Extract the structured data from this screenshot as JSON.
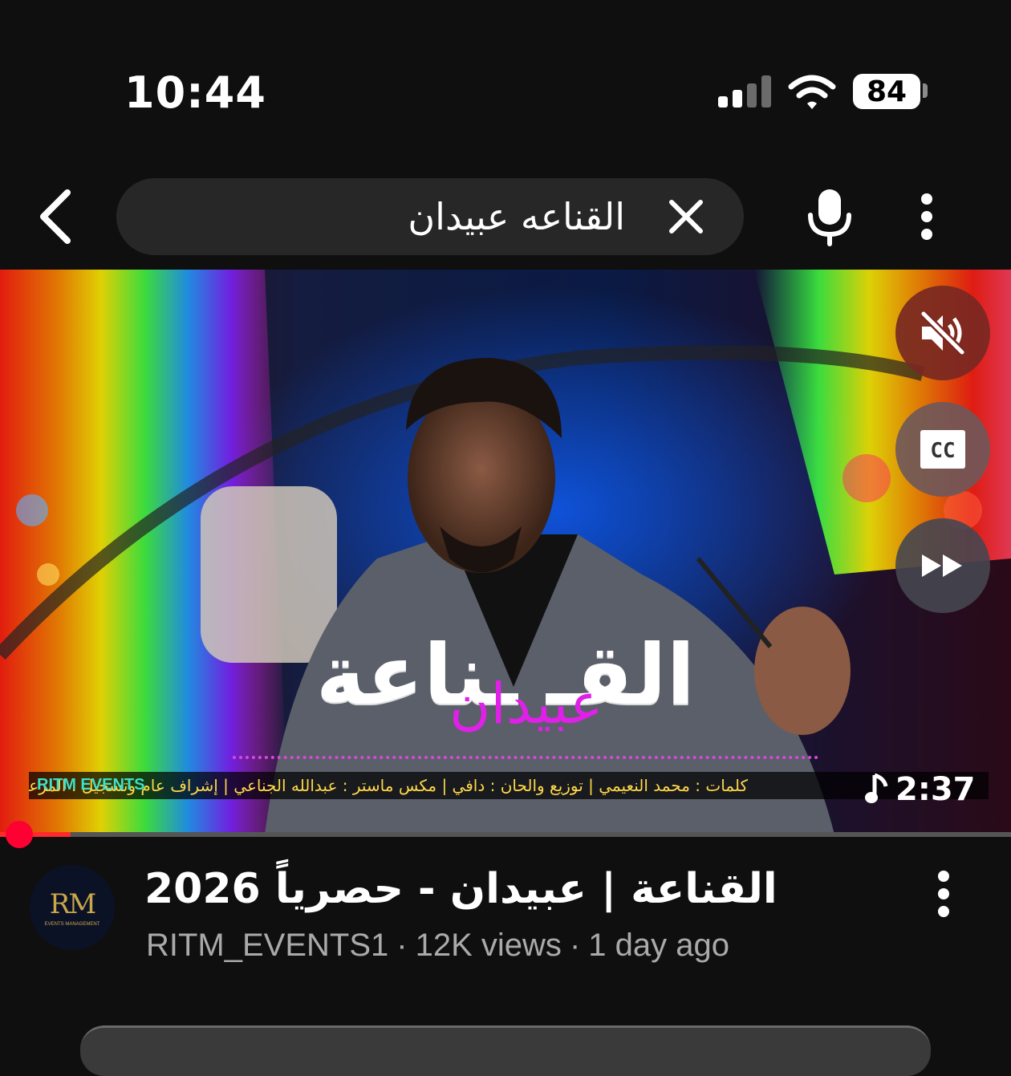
{
  "status_bar": {
    "time": "10:44",
    "battery": "84",
    "icons": [
      "signal-icon",
      "wifi-icon",
      "battery-icon"
    ]
  },
  "search": {
    "query": "القناعه عبيدان",
    "back_icon": "chevron-left-icon",
    "clear_icon": "close-icon",
    "mic_icon": "microphone-icon",
    "more_icon": "vertical-dots-icon"
  },
  "player": {
    "overlay_title_main": "القـ ـناعة",
    "overlay_title_name": "عبيدان",
    "credits": "كلمات : محمد النعيمي | توزيع والحان : دافي | مكس ماستر : عبدالله الجناعي | إشراف عام وتسجيل : المرعب | انتاج :",
    "credits_brand": "RITM EVENTS",
    "duration": "2:37",
    "progress_fraction": 0.07,
    "controls": [
      "mute-icon",
      "closed-captions-icon",
      "fast-forward-icon"
    ],
    "cc_label": "CC"
  },
  "video": {
    "title": "القناعة | عبيدان - حصرياً 2026",
    "channel": "RITM_EVENTS1",
    "views": "12K views",
    "age": "1 day ago",
    "separator": "·",
    "avatar_text": "RM",
    "avatar_subtext": "EVENTS MANAGEMENT"
  },
  "colors": {
    "background": "#0f0f0f",
    "search_box": "#272727",
    "progress": "#ff0033",
    "meta_text": "#aaaaaa",
    "overlay_name": "#e020e8"
  }
}
